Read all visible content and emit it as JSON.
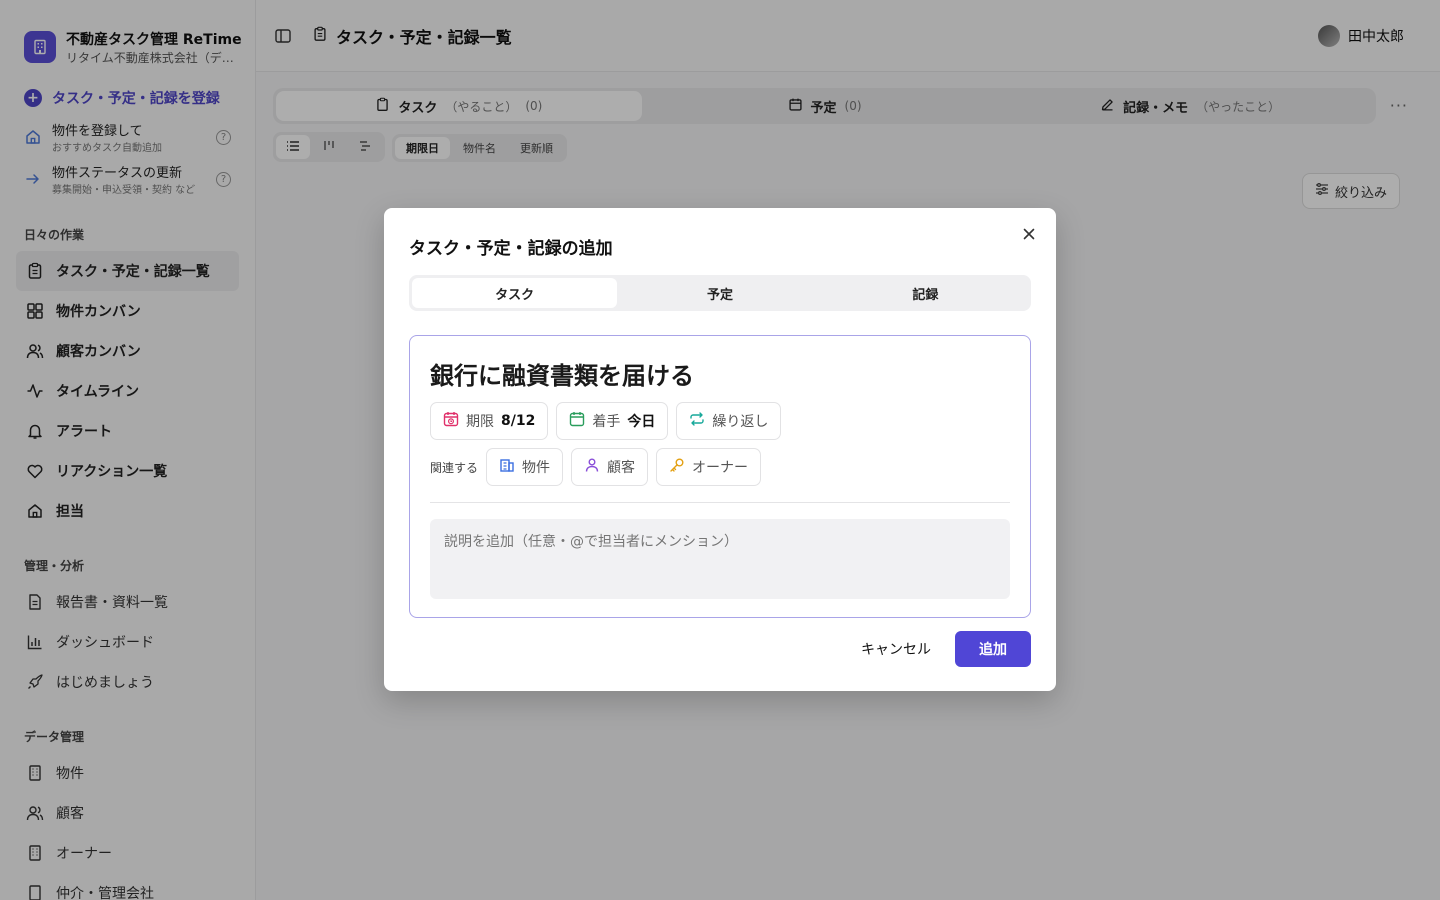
{
  "app": {
    "title": "不動産タスク管理 ReTime",
    "company": "リタイム不動産株式会社（デ…"
  },
  "quick_actions": {
    "primary": "タスク・予定・記録を登録",
    "items": [
      {
        "label": "物件を登録して",
        "sub": "おすすめタスク自動追加",
        "icon": "home-icon"
      },
      {
        "label": "物件ステータスの更新",
        "sub": "募集開始・申込受領・契約 など",
        "icon": "arrow-right-icon"
      }
    ]
  },
  "sections": {
    "daily": "日々の作業",
    "analysis": "管理・分析",
    "data": "データ管理"
  },
  "nav_daily": [
    {
      "label": "タスク・予定・記録一覧",
      "icon": "clipboard-icon",
      "active": true
    },
    {
      "label": "物件カンバン",
      "icon": "grid-icon"
    },
    {
      "label": "顧客カンバン",
      "icon": "users-icon"
    },
    {
      "label": "タイムライン",
      "icon": "activity-icon"
    },
    {
      "label": "アラート",
      "icon": "bell-icon"
    },
    {
      "label": "リアクション一覧",
      "icon": "heart-icon"
    },
    {
      "label": "担当",
      "icon": "home-icon"
    }
  ],
  "nav_analysis": [
    {
      "label": "報告書・資料一覧",
      "icon": "document-icon"
    },
    {
      "label": "ダッシュボード",
      "icon": "bar-chart-icon"
    },
    {
      "label": "はじめましょう",
      "icon": "rocket-icon"
    }
  ],
  "nav_data": [
    {
      "label": "物件",
      "icon": "building-icon"
    },
    {
      "label": "顧客",
      "icon": "users-icon"
    },
    {
      "label": "オーナー",
      "icon": "building-icon"
    },
    {
      "label": "仲介・管理会社",
      "icon": "building-icon"
    }
  ],
  "topbar": {
    "page_title": "タスク・予定・記録一覧",
    "user_name": "田中太郎"
  },
  "mode_tabs": [
    {
      "label": "タスク",
      "hint": "（やること）",
      "count": "(0)",
      "icon": "clipboard-icon",
      "active": true
    },
    {
      "label": "予定",
      "hint": "",
      "count": "(0)",
      "icon": "calendar-icon"
    },
    {
      "label": "記録・メモ",
      "hint": "（やったこと）",
      "count": "",
      "icon": "pencil-icon"
    }
  ],
  "sort_options": [
    "期限日",
    "物件名",
    "更新順"
  ],
  "filter_label": "絞り込み",
  "modal": {
    "title": "タスク・予定・記録の追加",
    "kind_tabs": [
      "タスク",
      "予定",
      "記録"
    ],
    "task_title": "銀行に融資書類を届ける",
    "due_label": "期限",
    "due_value": "8/12",
    "start_label": "着手",
    "start_value": "今日",
    "repeat_label": "繰り返し",
    "related_label": "関連する",
    "related": [
      "物件",
      "顧客",
      "オーナー"
    ],
    "desc_placeholder": "説明を追加（任意・@で担当者にメンション）",
    "cancel": "キャンセル",
    "submit": "追加"
  },
  "colors": {
    "accent": "#5046d6",
    "due_icon": "#e0306a",
    "start_icon": "#2a9d5c",
    "repeat_icon": "#17a89a",
    "property_icon": "#3b6fe0",
    "customer_icon": "#8a4fd8",
    "owner_icon": "#e3a012"
  }
}
